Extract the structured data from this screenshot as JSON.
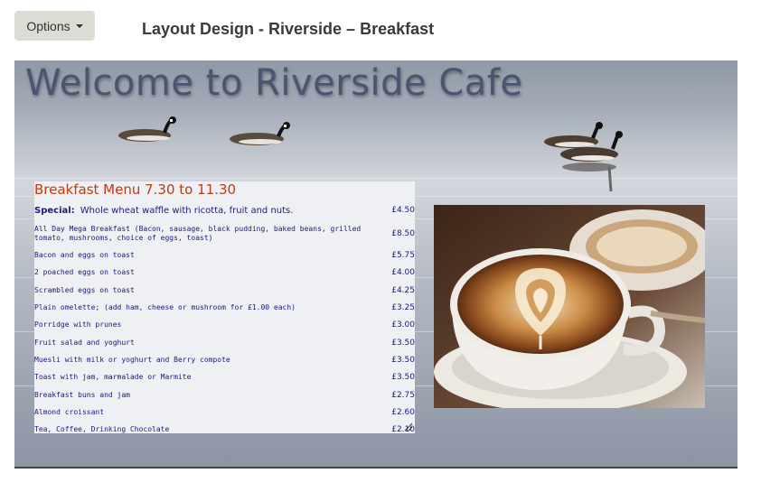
{
  "toolbar": {
    "options_label": "Options"
  },
  "page": {
    "title": "Layout Design - Riverside – Breakfast"
  },
  "banner": {
    "welcome": "Welcome to Riverside Cafe"
  },
  "menu": {
    "heading": "Breakfast Menu 7.30 to 11.30",
    "special_label": "Special:",
    "special_text": "Whole wheat waffle with ricotta, fruit and nuts.",
    "special_price": "£4.50",
    "items": [
      {
        "name": "All Day Mega Breakfast (Bacon, sausage, black pudding, baked beans, grilled tomato, mushrooms, choice of eggs, toast)",
        "price": "£8.50"
      },
      {
        "name": "Bacon and eggs on toast",
        "price": "£5.75"
      },
      {
        "name": "2 poached eggs on toast",
        "price": "£4.00"
      },
      {
        "name": "Scrambled eggs on toast",
        "price": "£4.25"
      },
      {
        "name": "Plain omelette; (add ham, cheese or mushroom for £1.00 each)",
        "price": "£3.25"
      },
      {
        "name": "Porridge with prunes",
        "price": "£3.00"
      },
      {
        "name": "Fruit salad and yoghurt",
        "price": "£3.50"
      },
      {
        "name": "Muesli with milk or yoghurt and Berry compote",
        "price": "£3.50"
      },
      {
        "name": "Toast with jam, marmalade or Marmite",
        "price": "£3.50"
      },
      {
        "name": "Breakfast buns and jam",
        "price": "£2.75"
      },
      {
        "name": "Almond croissant",
        "price": "£2.60"
      },
      {
        "name": "Tea, Coffee, Drinking Chocolate",
        "price": "£2.10"
      }
    ]
  },
  "colors": {
    "heading": "#c03a10",
    "menu_text": "#1a1a7a",
    "welcome_text": "#4b5570"
  }
}
